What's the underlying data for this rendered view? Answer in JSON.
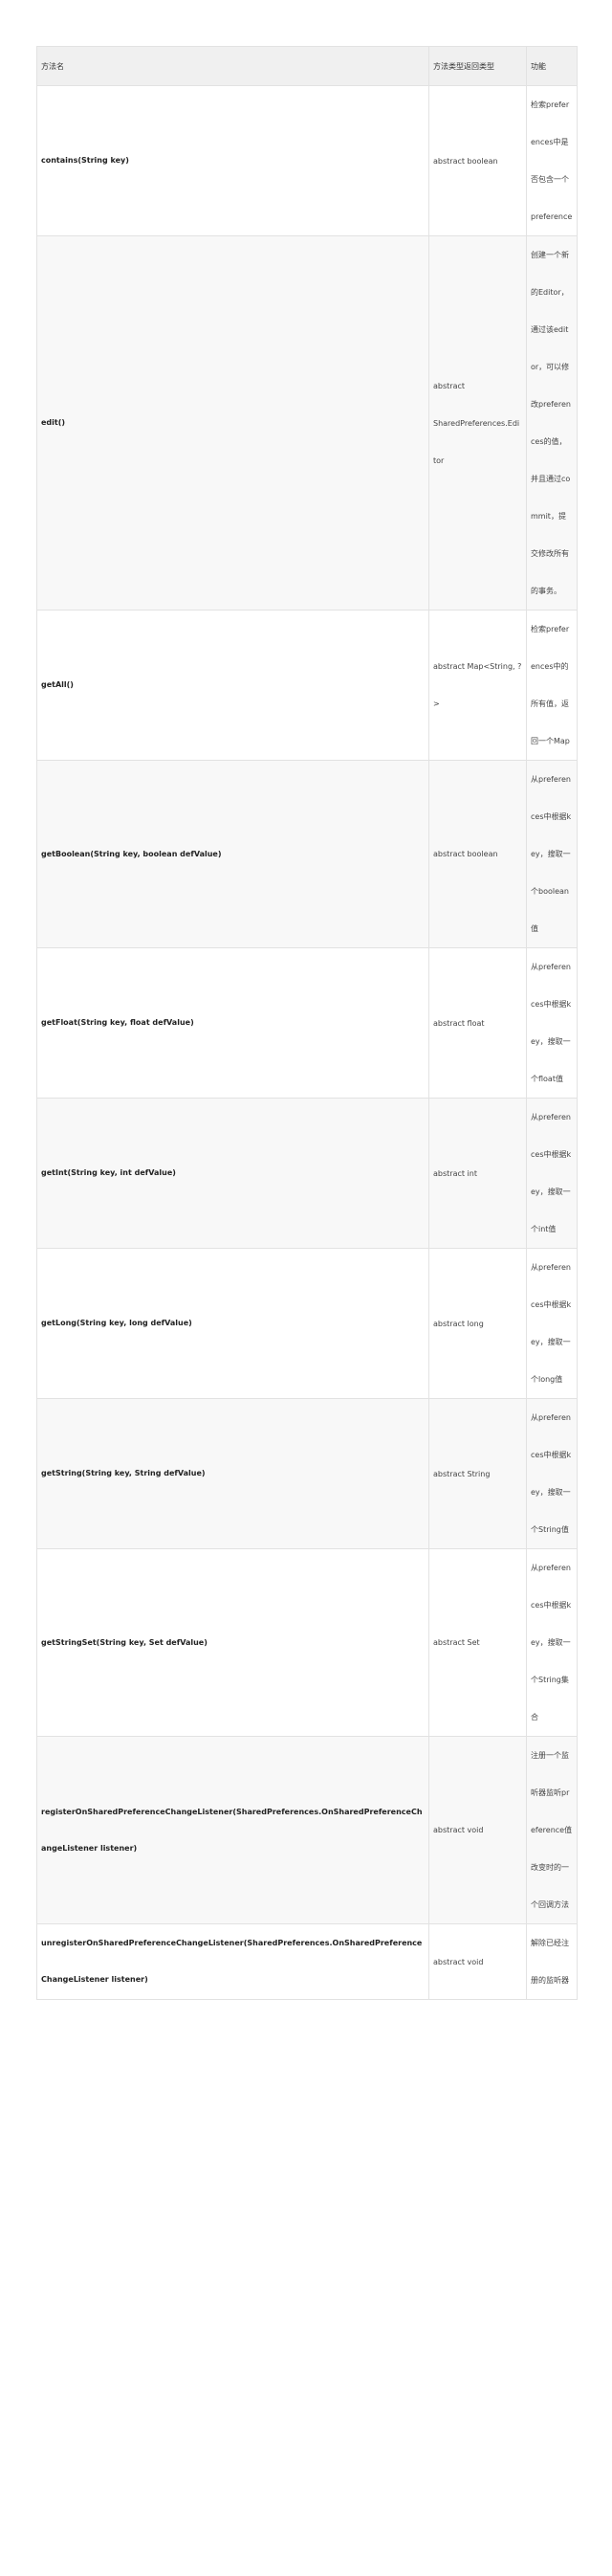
{
  "table": {
    "headers": [
      "方法名",
      "方法类型返回类型",
      "功能"
    ],
    "rows": [
      {
        "method": "contains(String key)",
        "type": "abstract boolean",
        "desc": "检索preferences中是否包含一个preference"
      },
      {
        "method": "edit()",
        "type": "abstract SharedPreferences.Editor",
        "desc": "创建一个新的Editor，通过该editor，可以修改preferences的值，并且通过commit，提交修改所有的事务。"
      },
      {
        "method": "getAll()",
        "type": "abstract Map<String, ?>",
        "desc": "检索preferences中的所有值，返回一个Map"
      },
      {
        "method": "getBoolean(String key, boolean defValue)",
        "type": "abstract boolean",
        "desc": "从preferences中根据key，搜取一个boolean值"
      },
      {
        "method": "getFloat(String key, float defValue)",
        "type": "abstract float",
        "desc": "从preferences中根据key，搜取一个float值"
      },
      {
        "method": "getInt(String key, int defValue)",
        "type": "abstract int",
        "desc": "从preferences中根据key，搜取一个int值"
      },
      {
        "method": "getLong(String key, long defValue)",
        "type": "abstract long",
        "desc": "从preferences中根据key，搜取一个long值"
      },
      {
        "method": "getString(String key, String defValue)",
        "type": "abstract String",
        "desc": "从preferences中根据key，搜取一个String值"
      },
      {
        "method": "getStringSet(String key, Set defValue)",
        "type": "abstract Set",
        "desc": "从preferences中根据key，搜取一个String集合"
      },
      {
        "method": "registerOnSharedPreferenceChangeListener(SharedPreferences.OnSharedPreferenceChangeListener listener)",
        "type": "abstract void",
        "desc": "注册一个监听器监听preference值改变时的一个回调方法"
      },
      {
        "method": "unregisterOnSharedPreferenceChangeListener(SharedPreferences.OnSharedPreferenceChangeListener listener)",
        "type": "abstract void",
        "desc": "解除已经注册的监听器"
      }
    ]
  }
}
